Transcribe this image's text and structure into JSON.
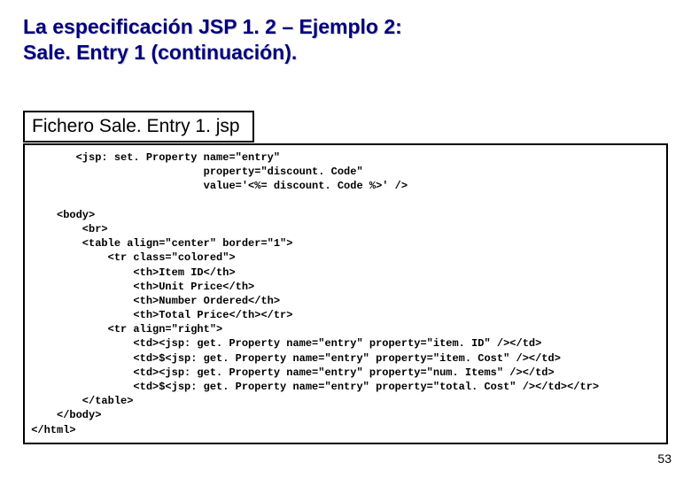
{
  "title": {
    "line1": "La especificación JSP 1. 2 – Ejemplo 2:",
    "line2": "Sale. Entry 1 (continuación)."
  },
  "file_label": "Fichero Sale. Entry 1. jsp",
  "code": "        <jsp: set. Property name=\"entry\"\n                            property=\"discount. Code\"\n                            value='<%= discount. Code %>' />\n\n     <body>\n         <br>\n         <table align=\"center\" border=\"1\">\n             <tr class=\"colored\">\n                 <th>Item ID</th>\n                 <th>Unit Price</th>\n                 <th>Number Ordered</th>\n                 <th>Total Price</th></tr>\n             <tr align=\"right\">\n                 <td><jsp: get. Property name=\"entry\" property=\"item. ID\" /></td>\n                 <td>$<jsp: get. Property name=\"entry\" property=\"item. Cost\" /></td>\n                 <td><jsp: get. Property name=\"entry\" property=\"num. Items\" /></td>\n                 <td>$<jsp: get. Property name=\"entry\" property=\"total. Cost\" /></td></tr>\n         </table>\n     </body>\n </html>",
  "page_number": "53"
}
